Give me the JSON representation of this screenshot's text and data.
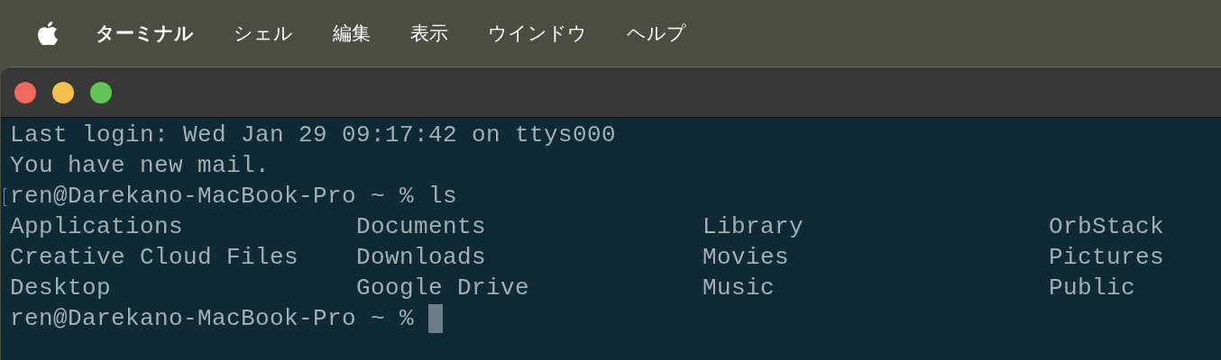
{
  "menu_bar": {
    "items": [
      {
        "label": "ターミナル",
        "kind": "app"
      },
      {
        "label": "シェル",
        "kind": "menu"
      },
      {
        "label": "編集",
        "kind": "menu"
      },
      {
        "label": "表示",
        "kind": "menu"
      },
      {
        "label": "ウインドウ",
        "kind": "menu"
      },
      {
        "label": "ヘルプ",
        "kind": "menu"
      }
    ]
  },
  "terminal": {
    "lines": [
      "Last login: Wed Jan 29 09:17:42 on ttys000",
      "You have new mail."
    ],
    "command": {
      "prompt": "ren@Darekano-MacBook-Pro ~ %",
      "input": "ls"
    },
    "listing": [
      [
        "Applications",
        "Documents",
        "Library",
        "OrbStack"
      ],
      [
        "Creative Cloud Files",
        "Downloads",
        "Movies",
        "Pictures"
      ],
      [
        "Desktop",
        "Google Drive",
        "Music",
        "Public"
      ]
    ],
    "current_prompt": "ren@Darekano-MacBook-Pro ~ %"
  }
}
